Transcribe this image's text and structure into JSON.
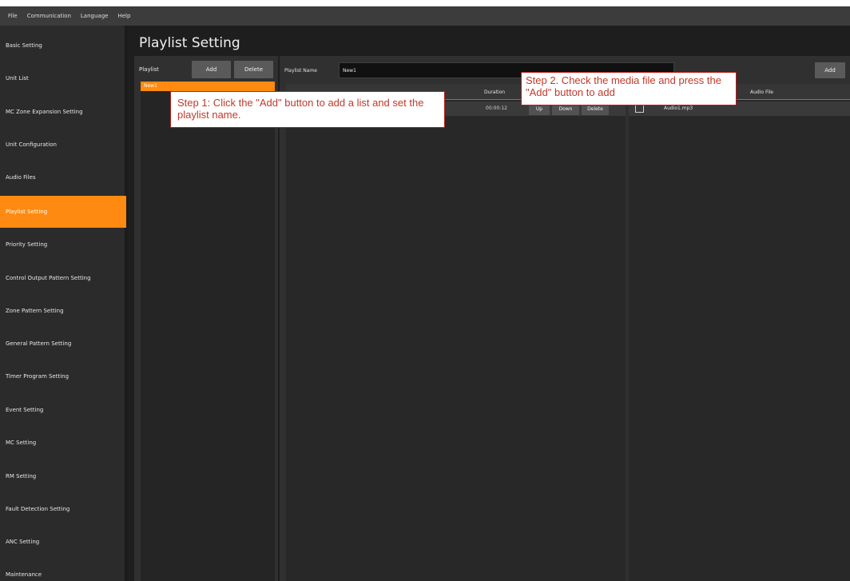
{
  "menu": [
    "File",
    "Communication",
    "Language",
    "Help"
  ],
  "sidebar": {
    "items": [
      {
        "label": "Basic Setting",
        "active": false
      },
      {
        "label": "Unit List",
        "active": false
      },
      {
        "label": "MC Zone Expansion Setting",
        "active": false
      },
      {
        "label": "Unit Configuration",
        "active": false
      },
      {
        "label": "Audio Files",
        "active": false
      },
      {
        "label": "Playlist Setting",
        "active": true
      },
      {
        "label": "Priority Setting",
        "active": false
      },
      {
        "label": "Control Output Pattern Setting",
        "active": false
      },
      {
        "label": "Zone Pattern Setting",
        "active": false
      },
      {
        "label": "General Pattern Setting",
        "active": false
      },
      {
        "label": "Timer Program Setting",
        "active": false
      },
      {
        "label": "Event Setting",
        "active": false
      },
      {
        "label": "MC Setting",
        "active": false
      },
      {
        "label": "RM Setting",
        "active": false
      },
      {
        "label": "Fault Detection Setting",
        "active": false
      },
      {
        "label": "ANC Setting",
        "active": false
      },
      {
        "label": "Maintenance",
        "active": false
      }
    ]
  },
  "main": {
    "title": "Playlist Setting",
    "playlist_panel": {
      "label": "Playlist",
      "add_label": "Add",
      "delete_label": "Delete",
      "items": [
        "New1"
      ]
    },
    "detail": {
      "name_label": "Playlist Name",
      "name_value": "New1",
      "add_label": "Add",
      "media_columns": {
        "duration": "Duration"
      },
      "media_rows": [
        {
          "duration": "00:00:12",
          "up": "Up",
          "down": "Down",
          "delete": "Delete"
        }
      ],
      "audio_columns": {
        "audio_file": "Audio File"
      },
      "audio_rows": [
        {
          "checked": false,
          "name": "Audio1.mp3"
        }
      ]
    }
  },
  "callouts": {
    "step1": "Step 1: Click the \"Add\" button to add a list and set the playlist name.",
    "step2": "Step 2. Check the media file and press the \"Add\" button to add"
  },
  "colors": {
    "accent": "#fe8a11",
    "callout_border": "#b71c1c",
    "callout_text": "#c0392b"
  }
}
